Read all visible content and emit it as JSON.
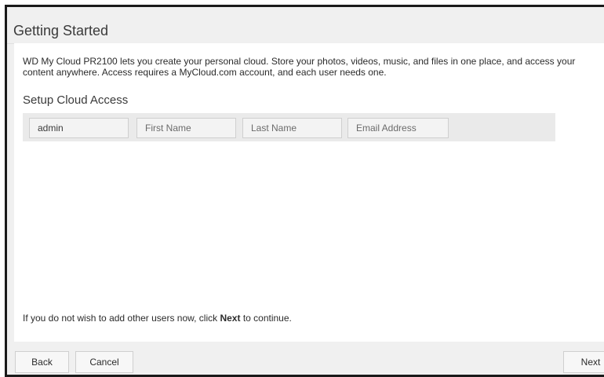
{
  "header": {
    "title": "Getting Started"
  },
  "intro": {
    "description": "WD My Cloud PR2100 lets you create your personal cloud. Store your photos, videos, music, and files in one place, and access your content anywhere. Access requires a MyCloud.com account, and each user needs one."
  },
  "setup": {
    "section_title": "Setup Cloud Access",
    "username_value": "admin",
    "first_name_placeholder": "First Name",
    "last_name_placeholder": "Last Name",
    "email_placeholder": "Email Address"
  },
  "hint": {
    "prefix": "If you do not wish to add other users now, click ",
    "strong": "Next",
    "suffix": " to continue."
  },
  "footer": {
    "back_label": "Back",
    "cancel_label": "Cancel",
    "next_label": "Next"
  }
}
